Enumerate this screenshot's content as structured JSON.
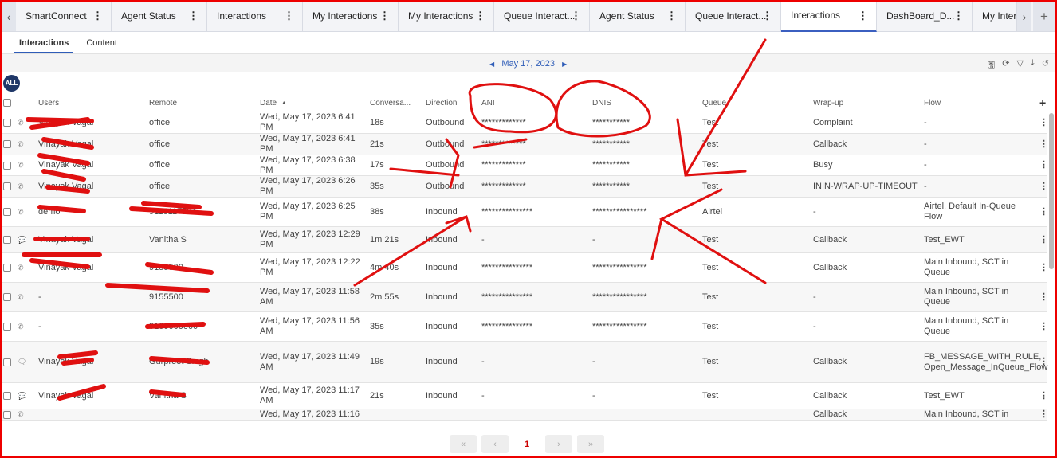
{
  "tabs": [
    {
      "label": "SmartConnect"
    },
    {
      "label": "Agent Status"
    },
    {
      "label": "Interactions"
    },
    {
      "label": "My Interactions"
    },
    {
      "label": "My Interactions"
    },
    {
      "label": "Queue Interact..."
    },
    {
      "label": "Agent Status"
    },
    {
      "label": "Queue Interact..."
    },
    {
      "label": "Interactions",
      "active": true
    },
    {
      "label": "DashBoard_D..."
    },
    {
      "label": "My Intera"
    }
  ],
  "subtabs": [
    "Interactions",
    "Content"
  ],
  "date": "May 17, 2023",
  "filter_all": "ALL",
  "columns": [
    "Users",
    "Remote",
    "Date",
    "Conversa...",
    "Direction",
    "ANI",
    "DNIS",
    "Queue",
    "Wrap-up",
    "Flow"
  ],
  "rows": [
    {
      "type": "phone",
      "user": "Vinayak Vagal",
      "remote": "office",
      "date": "Wed, May 17, 2023 6:41 PM",
      "dur": "18s",
      "dir": "Outbound",
      "ani": "*************",
      "dnis": "***********",
      "queue": "Test",
      "wrap": "Complaint",
      "flow": "-"
    },
    {
      "type": "phone",
      "user": "Vinayak Vagal",
      "remote": "office",
      "date": "Wed, May 17, 2023 6:41 PM",
      "dur": "21s",
      "dir": "Outbound",
      "ani": "*************",
      "dnis": "***********",
      "queue": "Test",
      "wrap": "Callback",
      "flow": "-"
    },
    {
      "type": "phone",
      "user": "Vinayak Vagal",
      "remote": "office",
      "date": "Wed, May 17, 2023 6:38 PM",
      "dur": "17s",
      "dir": "Outbound",
      "ani": "*************",
      "dnis": "***********",
      "queue": "Test",
      "wrap": "Busy",
      "flow": "-"
    },
    {
      "type": "phone",
      "user": "Vinayak Vagal",
      "remote": "office",
      "date": "Wed, May 17, 2023 6:26 PM",
      "dur": "35s",
      "dir": "Outbound",
      "ani": "*************",
      "dnis": "***********",
      "queue": "Test",
      "wrap": "ININ-WRAP-UP-TIMEOUT",
      "flow": "-"
    },
    {
      "type": "phone",
      "user": "demo",
      "remote": "9116117784",
      "date": "Wed, May 17, 2023 6:25 PM",
      "dur": "38s",
      "dir": "Inbound",
      "ani": "***************",
      "dnis": "****************",
      "queue": "Airtel",
      "wrap": "-",
      "flow": "Airtel, Default In-Queue Flow"
    },
    {
      "type": "chat",
      "user": "Vinayak Vagal",
      "remote": "Vanitha S",
      "date": "Wed, May 17, 2023 12:29 PM",
      "dur": "1m 21s",
      "dir": "Inbound",
      "ani": "-",
      "dnis": "-",
      "queue": "Test",
      "wrap": "Callback",
      "flow": "Test_EWT"
    },
    {
      "type": "phone",
      "user": "Vinayak Vagal",
      "remote": "9155500",
      "date": "Wed, May 17, 2023 12:22 PM",
      "dur": "4m 40s",
      "dir": "Inbound",
      "ani": "***************",
      "dnis": "****************",
      "queue": "Test",
      "wrap": "Callback",
      "flow": "Main Inbound, SCT in Queue"
    },
    {
      "type": "phone",
      "user": "-",
      "remote": "9155500",
      "date": "Wed, May 17, 2023 11:58 AM",
      "dur": "2m 55s",
      "dir": "Inbound",
      "ani": "***************",
      "dnis": "****************",
      "queue": "Test",
      "wrap": "-",
      "flow": "Main Inbound, SCT in Queue"
    },
    {
      "type": "phone",
      "user": "-",
      "remote": "9100000000",
      "date": "Wed, May 17, 2023 11:56 AM",
      "dur": "35s",
      "dir": "Inbound",
      "ani": "***************",
      "dnis": "****************",
      "queue": "Test",
      "wrap": "-",
      "flow": "Main Inbound, SCT in Queue"
    },
    {
      "type": "message",
      "user": "Vinayak Vagal",
      "remote": "Gurpreet Singh",
      "date": "Wed, May 17, 2023 11:49 AM",
      "dur": "19s",
      "dir": "Inbound",
      "ani": "-",
      "dnis": "-",
      "queue": "Test",
      "wrap": "Callback",
      "flow": "FB_MESSAGE_WITH_RULE, Open_Message_InQueue_Flow"
    },
    {
      "type": "chat",
      "user": "Vinayak Vagal",
      "remote": "Vanitha S",
      "date": "Wed, May 17, 2023 11:17 AM",
      "dur": "21s",
      "dir": "Inbound",
      "ani": "-",
      "dnis": "-",
      "queue": "Test",
      "wrap": "Callback",
      "flow": "Test_EWT"
    },
    {
      "type": "phone",
      "user": "",
      "remote": "",
      "date": "Wed, May 17, 2023 11:16 AM",
      "dur": "",
      "dir": "",
      "ani": "",
      "dnis": "",
      "queue": "",
      "wrap": "Callback",
      "flow": "Main Inbound, SCT in Queue"
    }
  ],
  "pager": {
    "first": "«",
    "prev": "‹",
    "current": "1",
    "next": "›",
    "last": "»"
  },
  "icons": {
    "save": "save-icon",
    "refresh": "refresh-icon",
    "filter": "filter-icon",
    "download": "download-icon",
    "reset": "undo-icon"
  }
}
